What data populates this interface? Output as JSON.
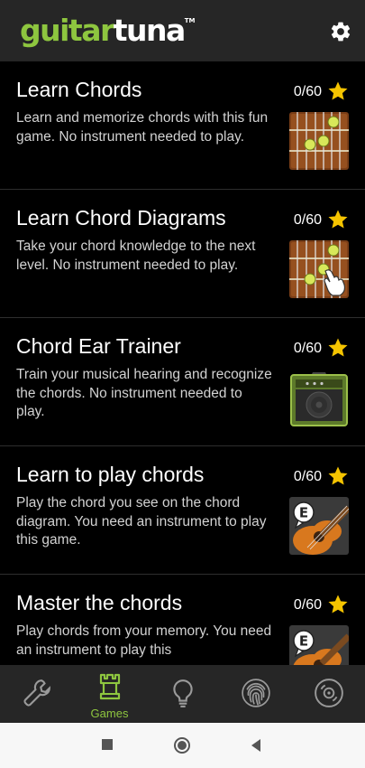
{
  "header": {
    "logo_part1": "guitar",
    "logo_part2": "tuna",
    "logo_tm": "TM",
    "settings_icon": "gear-icon"
  },
  "games": [
    {
      "title": "Learn Chords",
      "description": "Learn and memorize chords with this fun game. No instrument needed to play.",
      "score": "0/60",
      "thumbnail_icon": "fretboard-icon"
    },
    {
      "title": "Learn Chord Diagrams",
      "description": "Take your chord knowledge to the next level. No instrument needed to play.",
      "score": "0/60",
      "thumbnail_icon": "fretboard-hand-icon"
    },
    {
      "title": "Chord Ear Trainer",
      "description": "Train your musical hearing and recognize the chords. No instrument needed to play.",
      "score": "0/60",
      "thumbnail_icon": "amplifier-icon"
    },
    {
      "title": "Learn to play chords",
      "description": "Play the chord you see on the chord diagram. You need an instrument to play this game.",
      "score": "0/60",
      "thumbnail_icon": "guitar-e-icon"
    },
    {
      "title": "Master the chords",
      "description": "Play chords from your memory. You need an instrument to play this",
      "score": "0/60",
      "thumbnail_icon": "guitar-e-icon"
    }
  ],
  "bottom_nav": [
    {
      "icon": "wrench-icon",
      "label": ""
    },
    {
      "icon": "castle-tower-icon",
      "label": "Games",
      "active": true
    },
    {
      "icon": "lightbulb-icon",
      "label": ""
    },
    {
      "icon": "fingerprint-icon",
      "label": ""
    },
    {
      "icon": "vinyl-record-icon",
      "label": ""
    }
  ],
  "colors": {
    "accent_green": "#8ec63f",
    "star_yellow": "#f5c400",
    "header_bg": "#262626",
    "list_bg": "#000000"
  }
}
